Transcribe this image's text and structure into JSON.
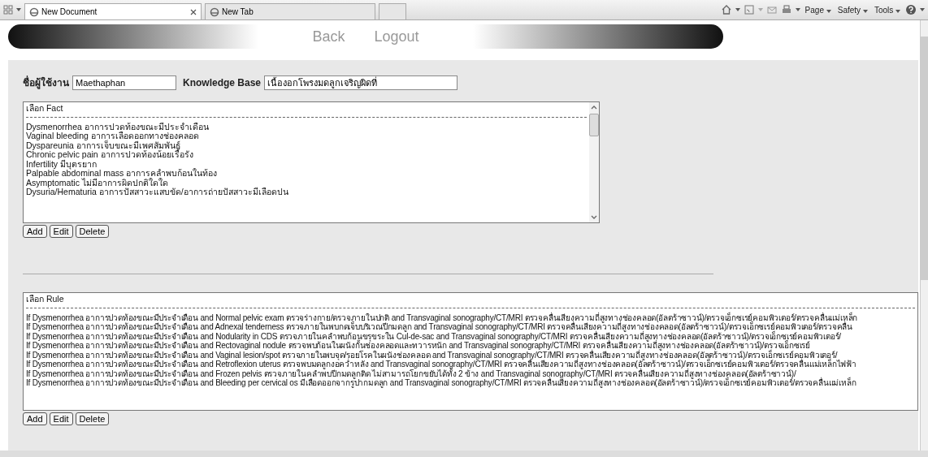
{
  "browser": {
    "tabs": [
      {
        "label": "New Document",
        "selected": true,
        "closable": true
      },
      {
        "label": "New Tab",
        "selected": false,
        "closable": false
      }
    ],
    "commands": [
      "Page",
      "Safety",
      "Tools"
    ]
  },
  "nav": {
    "links": [
      "Back",
      "Logout"
    ]
  },
  "form": {
    "username_label": "ชื่อผู้ใช้งาน",
    "username": "Maethaphan",
    "kb_label": "Knowledge Base",
    "kb_value": "เนื้องอกโพรงมดลูกเจริญผิดที่"
  },
  "fact_list": {
    "header": "เลือก Fact",
    "items": [
      "Dysmenorrhea อาการปวดท้องขณะมีประจำเดือน",
      "Vaginal bleeding อาการเลือดออกทางช่องคลอด",
      "Dyspareunia อาการเจ็บขณะมีเพศสัมพันธ์",
      "Chronic pelvic pain อาการปวดท้องน้อยเรื้อรัง",
      "Infertility มีบุตรยาก",
      "Palpable abdominal mass อาการคลำพบก้อนในท้อง",
      "Asymptomatic ไม่มีอาการผิดปกติใดใด",
      "Dysuria/Hematuria อาการปัสสาวะแสบขัด/อาการถ่ายปัสสาวะมีเลือดปน"
    ],
    "buttons": [
      "Add",
      "Edit",
      "Delete"
    ]
  },
  "rule_list": {
    "header": "เลือก Rule",
    "items": [
      "If Dysmenorrhea อาการปวดท้องขณะมีประจำเดือน and Normal pelvic exam ตรวจร่างกาย/ตรวจภายในปกติ and Transvaginal sonography/CT/MRI ตรวจคลื่นเสียงความถี่สูงทางช่องคลอด(อัลตร้าซาวน์)/ตรวจเอ็กซเรย์คอมพิวเตอร์/ตรวจคลื่นแม่เหล็ก",
      "If Dysmenorrhea อาการปวดท้องขณะมีประจำเดือน and Adnexal tenderness ตรวจภายในพบกดเจ็บบริเวณปีกมดลูก and Transvaginal sonography/CT/MRI ตรวจคลื่นเสียงความถี่สูงทางช่องคลอด(อัลตร้าซาวน์)/ตรวจเอ็กซเรย์คอมพิวเตอร์/ตรวจคลื่น",
      "If Dysmenorrhea อาการปวดท้องขณะมีประจำเดือน and Nodularity in CDS ตรวจภายในคลำพบก้อนขรุขระใน Cul-de-sac and Transvaginal sonography/CT/MRI ตรวจคลื่นเสียงความถี่สูงทางช่องคลอด(อัลตร้าซาวน์)/ตรวจเอ็กซเรย์คอมพิวเตอร์/",
      "If Dysmenorrhea อาการปวดท้องขณะมีประจำเดือน and Rectovaginal nodule ตรวจพบก้อนในผนังกั้นช่องคลอดและทวารหนัก and Transvaginal sonography/CT/MRI ตรวจคลื่นเสียงความถี่สูงทางช่องคลอด(อัลตร้าซาวน์)/ตรวจเอ็กซเรย์",
      "If Dysmenorrhea อาการปวดท้องขณะมีประจำเดือน and Vaginal lesion/spot ตรวจภายในพบจุด/รอยโรคในผนังช่องคลอด and Transvaginal sonography/CT/MRI ตรวจคลื่นเสียงความถี่สูงทางช่องคลอด(อัลตร้าซาวน์)/ตรวจเอ็กซเรย์คอมพิวเตอร์/",
      "If Dysmenorrhea อาการปวดท้องขณะมีประจำเดือน and Retroflexion uterus ตรวจพบมดลูกงอคว่ำหลัง and Transvaginal sonography/CT/MRI ตรวจคลื่นเสียงความถี่สูงทางช่องคลอด(อัลตร้าซาวน์)/ตรวจเอ็กซเรย์คอมพิวเตอร์/ตรวจคลื่นแม่เหล็กไฟฟ้า",
      "If Dysmenorrhea อาการปวดท้องขณะมีประจำเดือน and Frozen pelvis ตรวจภายในคลำพบปีกมดลูกติด ไม่สามารถโยกขยับได้ทั้ง 2 ข้าง and Transvaginal sonography/CT/MRI ตรวจคลื่นเสียงความถี่สูงทางช่องคลอด(อัลตร้าซาวน์)/",
      "If Dysmenorrhea อาการปวดท้องขณะมีประจำเดือน and Bleeding per cervical os มีเลือดออกจากรูปากมดลูก and Transvaginal sonography/CT/MRI ตรวจคลื่นเสียงความถี่สูงทางช่องคลอด(อัลตร้าซาวน์)/ตรวจเอ็กซเรย์คอมพิวเตอร์/ตรวจคลื่นแม่เหล็ก"
    ],
    "buttons": [
      "Add",
      "Edit",
      "Delete"
    ]
  }
}
